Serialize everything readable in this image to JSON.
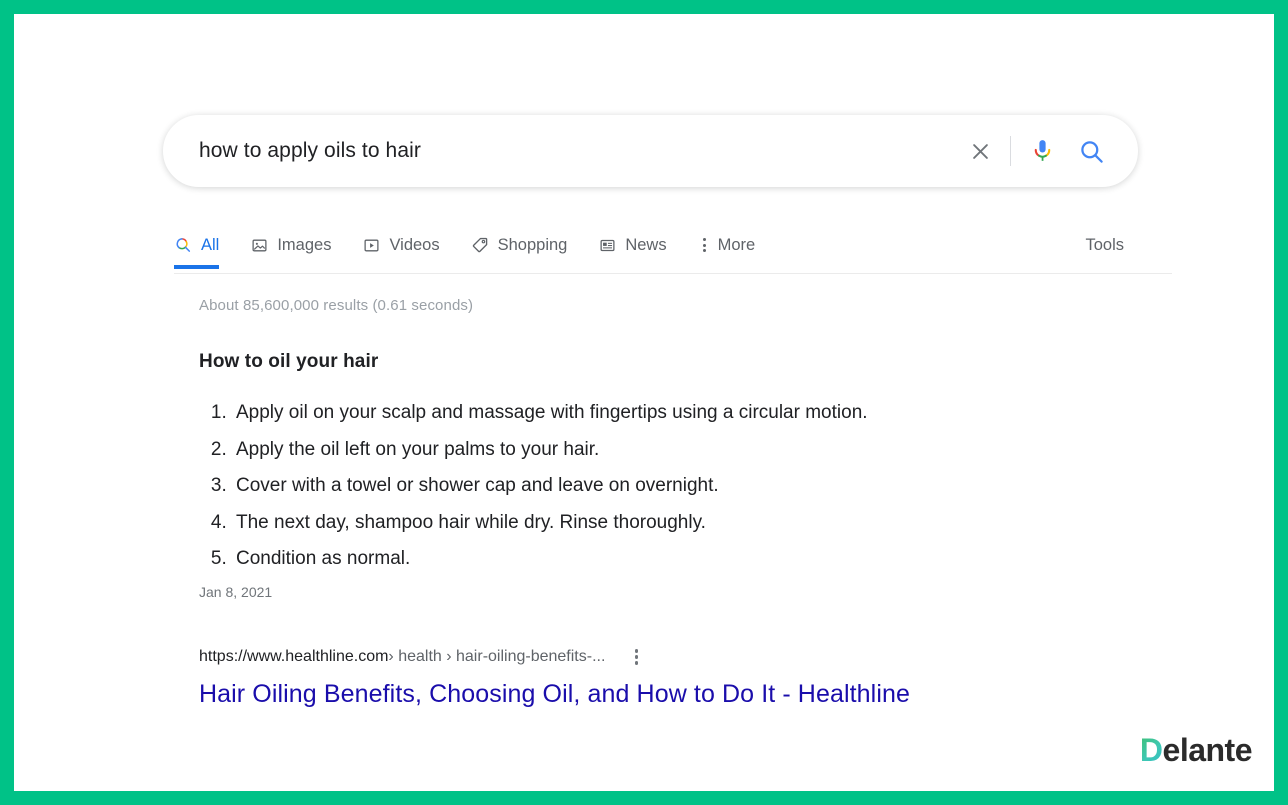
{
  "theme": {
    "frame_color": "#00c287",
    "link_color": "#1a0dab",
    "tab_active_color": "#1a73e8",
    "muted_text_color": "#70757a",
    "body_text_color": "#202124"
  },
  "search": {
    "query": "how to apply oils to hair",
    "placeholder": "Search",
    "clear_icon": "close-icon",
    "mic_icon": "microphone-icon",
    "search_icon": "search-icon"
  },
  "tabs": [
    {
      "label": "All",
      "icon": "google-search-icon",
      "active": true
    },
    {
      "label": "Images",
      "icon": "image-icon",
      "active": false
    },
    {
      "label": "Videos",
      "icon": "video-icon",
      "active": false
    },
    {
      "label": "Shopping",
      "icon": "tag-icon",
      "active": false
    },
    {
      "label": "News",
      "icon": "newspaper-icon",
      "active": false
    },
    {
      "label": "More",
      "icon": "more-vertical-icon",
      "active": false
    }
  ],
  "tools_label": "Tools",
  "results": {
    "stats": "About 85,600,000 results (0.61 seconds)",
    "featured_snippet": {
      "title": "How to oil your hair",
      "steps": [
        "Apply oil on your scalp and massage with fingertips using a circular motion.",
        "Apply the oil left on your palms to your hair.",
        "Cover with a towel or shower cap and leave on overnight.",
        "The next day, shampoo hair while dry. Rinse thoroughly.",
        "Condition as normal."
      ],
      "date": "Jan 8, 2021",
      "url_host": "https://www.healthline.com",
      "url_crumbs": " › health › hair-oiling-benefits-...",
      "menu_icon": "more-vertical-icon",
      "link_title": "Hair Oiling Benefits, Choosing Oil, and How to Do It - Healthline"
    }
  },
  "branding": {
    "logo_first_letter": "D",
    "logo_rest": "elante"
  }
}
